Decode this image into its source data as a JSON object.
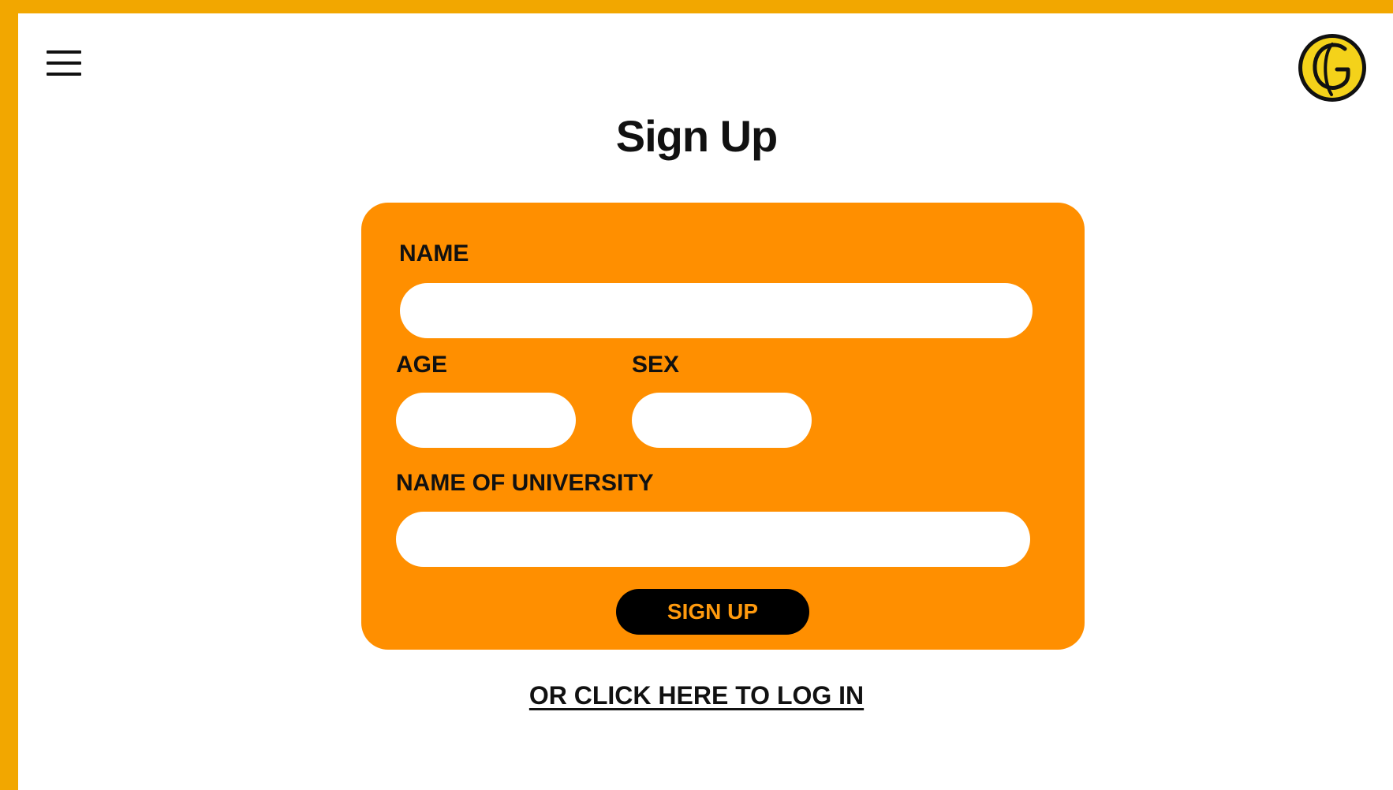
{
  "page": {
    "title": "Sign Up",
    "colors": {
      "frame": "#F2A700",
      "card": "#FF8F00",
      "button_bg": "#000000",
      "button_text": "#FF9A0E",
      "logo": "#F4D21A"
    }
  },
  "header": {
    "menu_icon": "hamburger-menu-icon",
    "logo_icon": "g-logo-icon",
    "logo_letter": "G"
  },
  "form": {
    "name_label": "NAME",
    "name_value": "",
    "age_label": "AGE",
    "age_value": "",
    "sex_label": "SEX",
    "sex_value": "",
    "university_label": "NAME OF UNIVERSITY",
    "university_value": "",
    "submit_label": "SIGN UP"
  },
  "footer": {
    "login_link": "OR CLICK HERE TO LOG IN"
  }
}
